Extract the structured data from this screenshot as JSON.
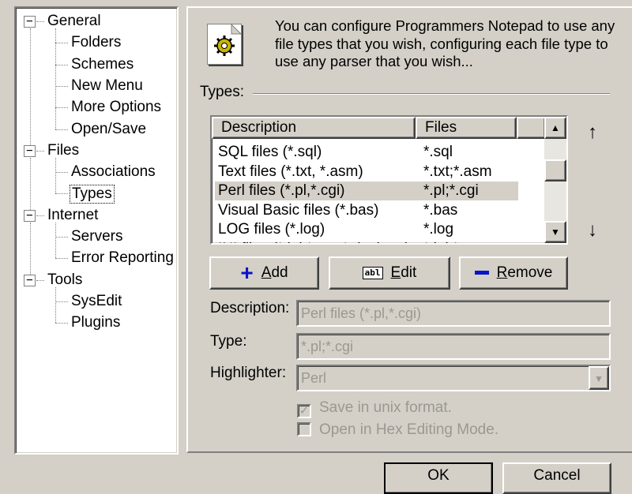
{
  "tree": {
    "groups": [
      {
        "label": "General",
        "children": [
          "Folders",
          "Schemes",
          "New Menu",
          "More Options",
          "Open/Save"
        ]
      },
      {
        "label": "Files",
        "children": [
          "Associations",
          "Types"
        ]
      },
      {
        "label": "Internet",
        "children": [
          "Servers",
          "Error Reporting"
        ]
      },
      {
        "label": "Tools",
        "children": [
          "SysEdit",
          "Plugins"
        ]
      }
    ],
    "selected": "Types",
    "expander_symbol": "−"
  },
  "intro_text": "You can configure Programmers Notepad to use any file types that you wish, configuring each file type to use any parser that you wish...",
  "types_label": "Types:",
  "list": {
    "columns": [
      "Description",
      "Files"
    ],
    "rows": [
      {
        "description": "SQL files (*.sql)",
        "files": "*.sql"
      },
      {
        "description": "Text files (*.txt, *.asm)",
        "files": "*.txt;*.asm"
      },
      {
        "description": "Perl files (*.pl,*.cgi)",
        "files": "*.pl;*.cgi"
      },
      {
        "description": "Visual Basic files (*.bas)",
        "files": "*.bas"
      },
      {
        "description": "LOG files (*.log)",
        "files": "*.log"
      },
      {
        "description": "INI files (*.ini;*.reg;*.desktop)",
        "files": "*.ini;*.reg"
      }
    ],
    "selected_index": 2
  },
  "side_arrows": {
    "up": "↑",
    "down": "↓"
  },
  "buttons": {
    "add": {
      "label_first": "A",
      "label_rest": "dd",
      "icon": "plus-icon"
    },
    "edit": {
      "label_first": "E",
      "label_rest": "dit",
      "icon_text": "abl"
    },
    "remove": {
      "label_first": "R",
      "label_rest": "emove",
      "icon": "minus-icon"
    }
  },
  "form": {
    "description_label": "Description:",
    "description_value": "Perl files (*.pl,*.cgi)",
    "type_label": "Type:",
    "type_value": "*.pl;*.cgi",
    "highlighter_label": "Highlighter:",
    "highlighter_value": "Perl",
    "save_unix_label": "Save in unix format.",
    "save_unix_checked": true,
    "hex_label": "Open in Hex Editing Mode.",
    "hex_checked": false,
    "check_mark": "✓"
  },
  "dialog_buttons": {
    "ok": "OK",
    "cancel": "Cancel"
  },
  "colors": {
    "face": "#d4d0c8",
    "disabled_text": "#9a9890",
    "accent_blue": "#0a14c8"
  }
}
